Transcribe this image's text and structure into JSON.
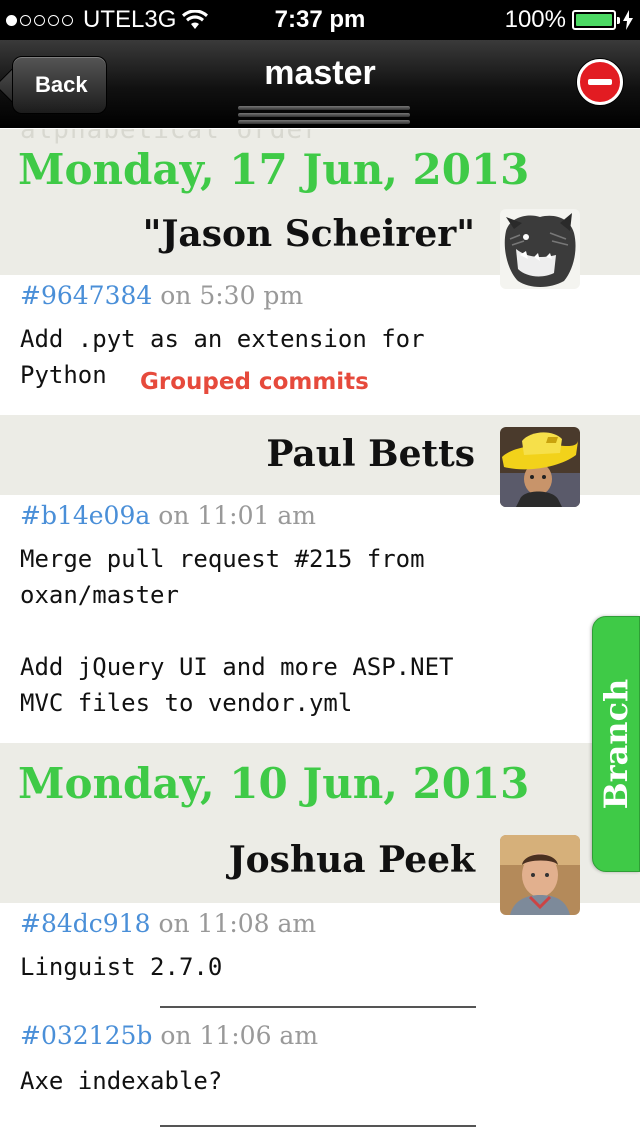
{
  "status_bar": {
    "carrier": "UTEL3G",
    "time": "7:37 pm",
    "battery": "100%",
    "signal_bars": 1
  },
  "nav": {
    "back_label": "Back",
    "title": "master"
  },
  "ghost_text": "alphabetical order",
  "annotation": "Grouped commits",
  "branch_tab": "Branch",
  "groups": [
    {
      "date": "Monday, 17 Jun, 2013",
      "authors": [
        {
          "name": "\"Jason Scheirer\"",
          "avatar": "bear-avatar",
          "commits": [
            {
              "sha": "#9647384",
              "time": "on 5:30 pm",
              "message": "Add .pyt as an extension for\nPython"
            }
          ]
        },
        {
          "name": "Paul Betts",
          "avatar": "yellow-hat-avatar",
          "commits": [
            {
              "sha": "#b14e09a",
              "time": "on 11:01 am",
              "message": "Merge pull request #215 from\noxan/master\n\nAdd jQuery UI and more ASP.NET\nMVC files to vendor.yml"
            }
          ]
        }
      ]
    },
    {
      "date": "Monday, 10 Jun, 2013",
      "authors": [
        {
          "name": "Joshua Peek",
          "avatar": "photo-avatar",
          "commits": [
            {
              "sha": "#84dc918",
              "time": "on 11:08 am",
              "message": "Linguist 2.7.0"
            },
            {
              "sha": "#032125b",
              "time": "on 11:06 am",
              "message": "Axe indexable?"
            }
          ]
        }
      ]
    }
  ],
  "colors": {
    "date_green": "#3fca47",
    "sha_blue": "#4a8fd8",
    "band_grey": "#ececE6",
    "annotation_red": "#e64a3c"
  }
}
